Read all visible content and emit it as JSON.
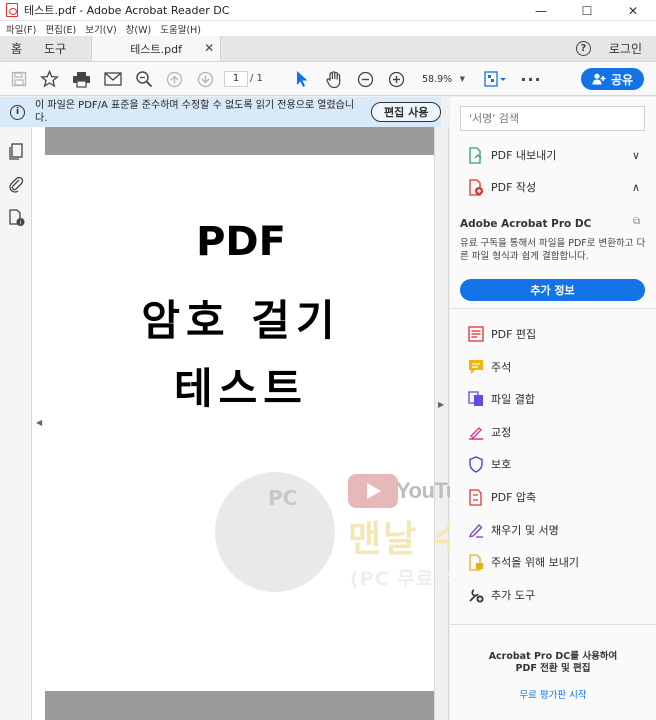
{
  "window": {
    "title": "테스트.pdf - Adobe Acrobat Reader DC",
    "controls": [
      "—",
      "☐",
      "✕"
    ]
  },
  "menu": [
    "파일(F)",
    "편집(E)",
    "보기(V)",
    "창(W)",
    "도움말(H)"
  ],
  "tabs": {
    "home": "홈",
    "tools": "도구",
    "document": "테스트.pdf",
    "login": "로그인"
  },
  "toolbar": {
    "page_current": "1",
    "page_total": "/ 1",
    "zoom": "58.9%",
    "share_label": "공유"
  },
  "banner": {
    "text": "이 파일은 PDF/A 표준을 준수하며 수정할 수 없도록 읽기 전용으로 열렸습니다.",
    "button": "편집 사용"
  },
  "document": {
    "lines": [
      "PDF",
      "암호 걸기",
      "테스트"
    ]
  },
  "watermark": {
    "pc": "PC",
    "youtube": "YouTube",
    "name": "맨날 수리야",
    "subtitle": "(PC 무료 수리, 꿀팁)"
  },
  "right_panel": {
    "search_placeholder": "'서명' 검색",
    "export_pdf": "PDF 내보내기",
    "create_pdf": "PDF 작성",
    "pro_title": "Adobe Acrobat Pro DC",
    "pro_desc": "유료 구독을 통해서 파일을 PDF로 변환하고 다른 파일 형식과 쉽게 결합합니다.",
    "pro_button": "추가 정보",
    "tools": [
      {
        "label": "PDF 편집",
        "icon": "edit-pdf-icon",
        "color": "#e0312f"
      },
      {
        "label": "주석",
        "icon": "comment-icon",
        "color": "#f3b512"
      },
      {
        "label": "파일 결합",
        "icon": "combine-files-icon",
        "color": "#5a4ee8"
      },
      {
        "label": "교정",
        "icon": "redact-icon",
        "color": "#d9328b"
      },
      {
        "label": "보호",
        "icon": "protect-icon",
        "color": "#3b4ec2"
      },
      {
        "label": "PDF 압축",
        "icon": "compress-pdf-icon",
        "color": "#d83a3a"
      },
      {
        "label": "채우기 및 서명",
        "icon": "fill-sign-icon",
        "color": "#7d3fc8"
      },
      {
        "label": "주석을 위해 보내기",
        "icon": "send-for-comments-icon",
        "color": "#e4b01b"
      },
      {
        "label": "추가 도구",
        "icon": "more-tools-icon",
        "color": "#333333"
      }
    ],
    "footer_text": "Acrobat Pro DC를 사용하여 PDF 전환 및 편집",
    "footer_link": "무료 평가판 시작"
  },
  "colors": {
    "accent": "#1473e6",
    "banner_bg": "#d8e9f9",
    "page_margin_grey": "#9b9b9b"
  }
}
